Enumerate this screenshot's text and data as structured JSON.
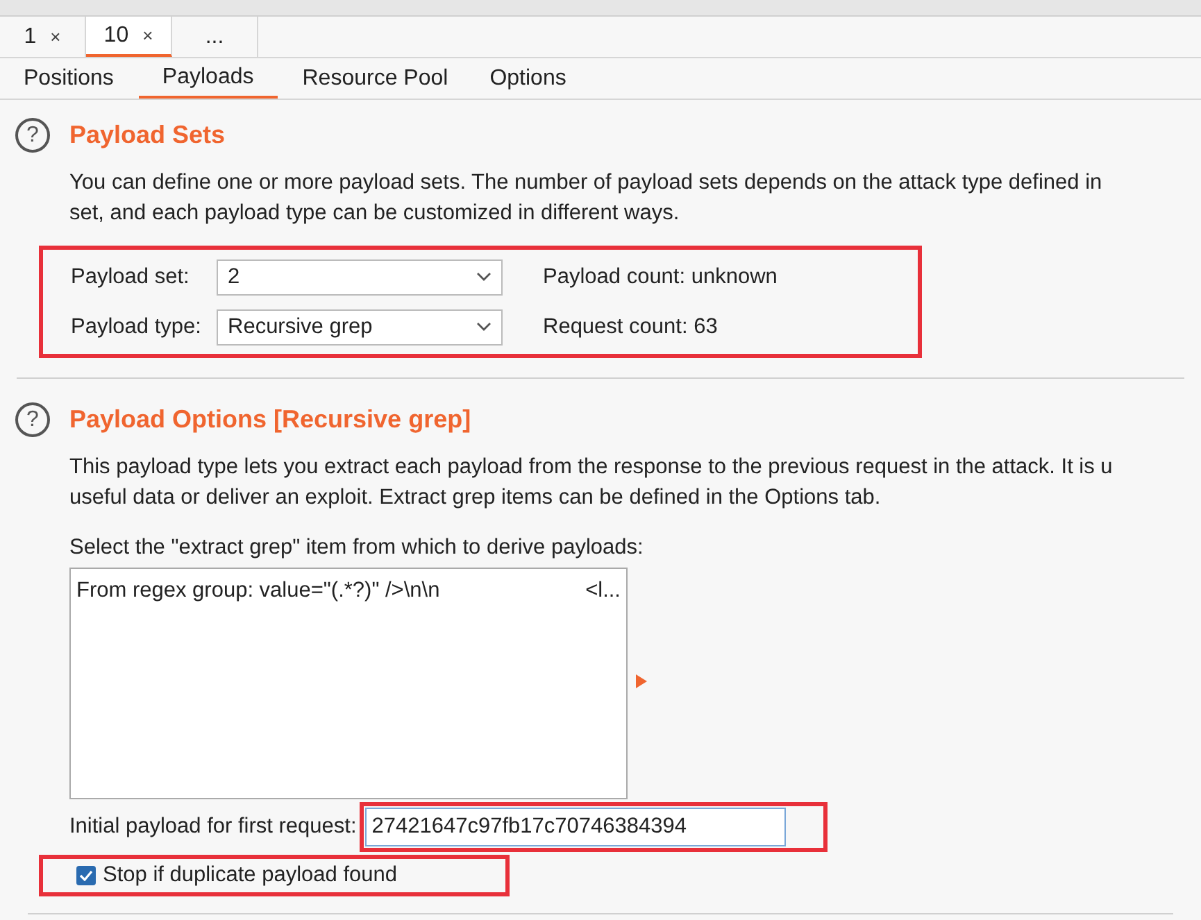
{
  "instance_tabs": [
    {
      "label": "1",
      "close": "×",
      "selected": false
    },
    {
      "label": "10",
      "close": "×",
      "selected": true
    },
    {
      "label": "...",
      "selected": false
    }
  ],
  "sub_tabs": [
    {
      "label": "Positions",
      "selected": false
    },
    {
      "label": "Payloads",
      "selected": true
    },
    {
      "label": "Resource Pool",
      "selected": false
    },
    {
      "label": "Options",
      "selected": false
    }
  ],
  "payload_sets": {
    "help": "?",
    "title": "Payload Sets",
    "description": [
      "You can define one or more payload sets. The number of payload sets depends on the attack type defined in",
      "set, and each payload type can be customized in different ways."
    ],
    "rows": [
      {
        "label": "Payload set:",
        "value": "2",
        "info": "Payload count: unknown"
      },
      {
        "label": "Payload type:",
        "value": "Recursive grep",
        "info": "Request count: 63"
      }
    ]
  },
  "payload_options": {
    "help": "?",
    "title": "Payload Options [Recursive grep]",
    "description": [
      "This payload type lets you extract each payload from the response to the previous request in the attack. It is u",
      "useful data or deliver an exploit. Extract grep items can be defined in the Options tab."
    ],
    "list_label": "Select the \"extract grep\" item from which to derive payloads:",
    "list_items": [
      {
        "source": "From regex group:  value=\"(.*?)\" />\\n\\n",
        "column_2": "<l..."
      }
    ],
    "initial_label": "Initial payload for first request:",
    "initial_value": "27421647c97fb17c70746384394",
    "stop_duplicate": {
      "label": "Stop if duplicate payload found",
      "checked": true
    }
  }
}
